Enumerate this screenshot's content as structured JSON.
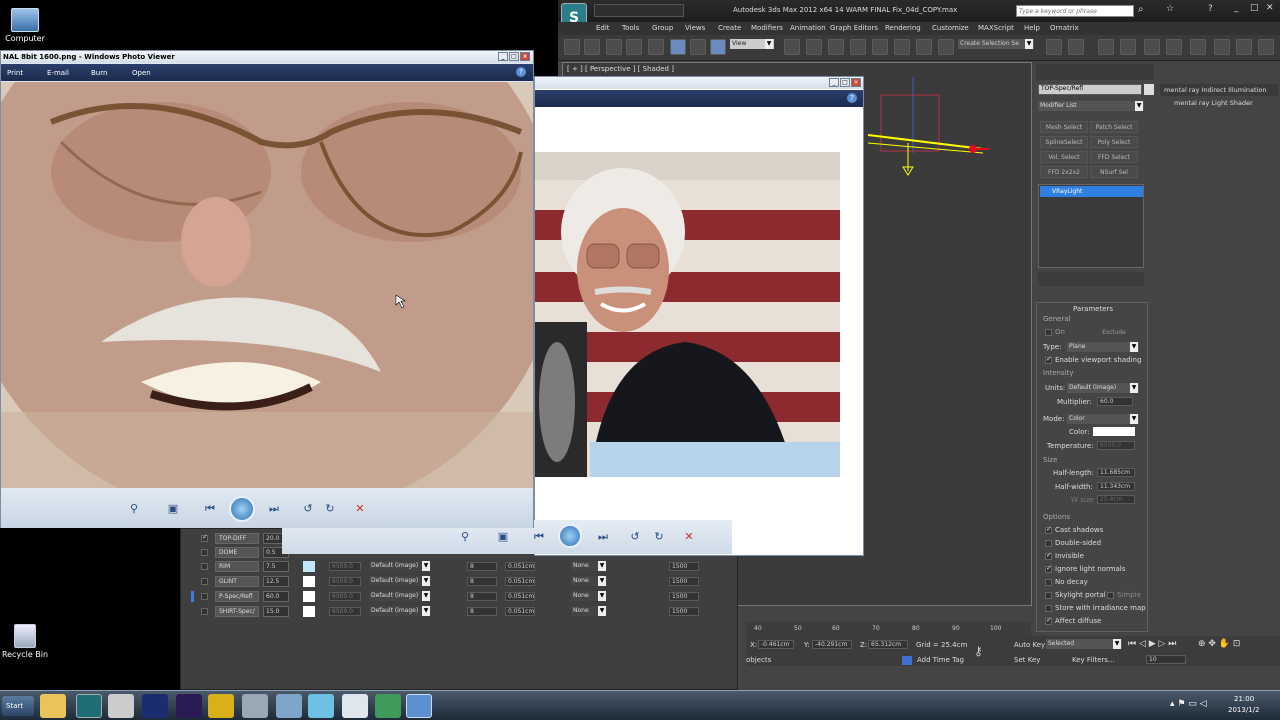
{
  "desktop": {
    "icons": [
      {
        "label": "Computer"
      },
      {
        "label": "Recycle Bin"
      }
    ]
  },
  "max": {
    "title": "Autodesk 3ds Max 2012 x64     14 WARM FINAL Fix_04d_COPY.max",
    "search_placeholder": "Type a keyword or phrase",
    "menu": [
      "Edit",
      "Tools",
      "Group",
      "Views",
      "Create",
      "Modifiers",
      "Animation",
      "Graph Editors",
      "Rendering",
      "Customize",
      "MAXScript",
      "Help",
      "Ornatrix"
    ],
    "view_dropdown": "View",
    "selection_set": "Create Selection Se",
    "viewport_label": "[ + ] [ Perspective ] [ Shaded ]",
    "object_name": "TOP-Spec/Refl",
    "modifier_list": "Modifier List",
    "modifier_buttons": [
      "Mesh Select",
      "Patch Select",
      "SplineSelect",
      "Poly Select",
      "Vol. Select",
      "FFD Select",
      "FFD 2x2x2",
      "NSurf Sel"
    ],
    "stack_item": "VRayLight",
    "right_panel": [
      "mental ray Indirect Illumination",
      "mental ray Light Shader"
    ],
    "params": {
      "header": "Parameters",
      "general": "General",
      "on": "On",
      "exclude": "Exclude",
      "type_label": "Type:",
      "type_value": "Plane",
      "enable_viewport_shading": "Enable viewport shading",
      "intensity": "Intensity",
      "units_label": "Units:",
      "units_value": "Default (image)",
      "multiplier_label": "Multiplier:",
      "multiplier_value": "60.0",
      "mode_label": "Mode:",
      "mode_value": "Color",
      "color_label": "Color:",
      "temperature_label": "Temperature:",
      "temperature_value": "6500.0",
      "size": "Size",
      "half_length_label": "Half-length:",
      "half_length_value": "11.685cm",
      "half_width_label": "Half-width:",
      "half_width_value": "11.343cm",
      "w_size_label": "W size",
      "w_size_value": "25.4cm",
      "options": "Options",
      "cast_shadows": "Cast shadows",
      "double_sided": "Double-sided",
      "invisible": "Invisible",
      "ignore_light_normals": "Ignore light normals",
      "no_decay": "No decay",
      "skylight_portal": "Skylight portal",
      "simple": "Simple",
      "store_irradiance": "Store with irradiance map",
      "affect_diffuse": "Affect diffuse"
    },
    "timeline_ticks": [
      "40",
      "50",
      "60",
      "70",
      "80",
      "90",
      "100"
    ],
    "status": {
      "x_label": "X:",
      "x_value": "-0.461cm",
      "y_label": "Y:",
      "y_value": "-40.291cm",
      "z_label": "Z:",
      "z_value": "65.312cm",
      "grid": "Grid = 25.4cm",
      "objects": "objects",
      "add_time_tag": "Add Time Tag",
      "auto_key": "Auto Key",
      "selected": "Selected",
      "set_key": "Set Key",
      "key_filters": "Key Filters...",
      "frame": "10"
    }
  },
  "lister": {
    "rows": [
      {
        "name": "TOP-DIFF",
        "mult": "20.0"
      },
      {
        "name": "DOME",
        "mult": "0.5"
      },
      {
        "name": "RIM",
        "mult": "7.5",
        "map": "Default (image)",
        "samples": "8",
        "bias": "0.051cm",
        "shadow": "None",
        "res": "1500"
      },
      {
        "name": "GLINT",
        "mult": "12.5",
        "map": "Default (image)",
        "samples": "8",
        "bias": "0.051cm",
        "shadow": "None",
        "res": "1500"
      },
      {
        "name": "P-Spec/Refl",
        "mult": "60.0",
        "map": "Default (image)",
        "samples": "8",
        "bias": "0.051cm",
        "shadow": "None",
        "res": "1500"
      },
      {
        "name": "SHIRT-Spec/",
        "mult": "15.0",
        "map": "Default (image)",
        "samples": "8",
        "bias": "0.051cm",
        "shadow": "None",
        "res": "1500"
      }
    ],
    "temp": "6500.0"
  },
  "photo_viewer": {
    "title": "NAL 8bit 1600.png - Windows Photo Viewer",
    "menu": [
      "Print",
      "E-mail",
      "Burn",
      "Open"
    ]
  },
  "taskbar": {
    "start": "Start",
    "time": "21:00",
    "date": "2013/1/2"
  },
  "colors": {
    "max_bg": "#444444",
    "selection_blue": "#2f7fe0",
    "taskbar": "#1d2a38"
  }
}
